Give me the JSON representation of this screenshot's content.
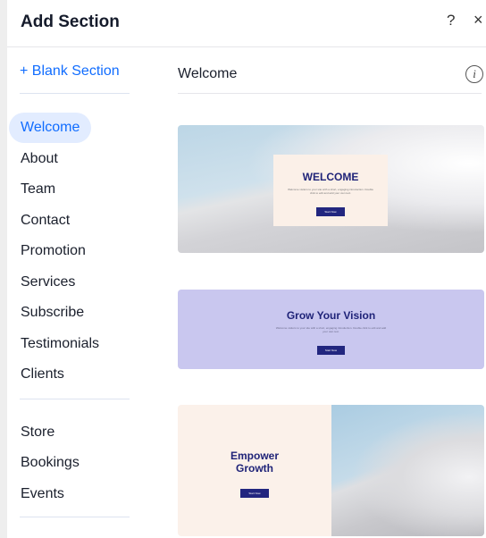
{
  "header": {
    "title": "Add Section",
    "help_label": "?",
    "close_label": "×"
  },
  "sidebar": {
    "blank_section": "+ Blank Section",
    "group1": [
      "Welcome",
      "About",
      "Team",
      "Contact",
      "Promotion",
      "Services",
      "Subscribe",
      "Testimonials",
      "Clients"
    ],
    "group2": [
      "Store",
      "Bookings",
      "Events"
    ],
    "active": "Welcome"
  },
  "main": {
    "title": "Welcome",
    "info_label": "i",
    "cards": [
      {
        "heading": "WELCOME",
        "body": "Welcome visitors to your site with a short, engaging introduction. Double click to edit and add your own text.",
        "button": "Start Now"
      },
      {
        "heading": "Grow Your Vision",
        "body": "Welcome visitors to your site with a short, engaging introduction. Double click to edit and add your own text.",
        "button": "Start Now"
      },
      {
        "heading_line1": "Empower",
        "heading_line2": "Growth",
        "button": "Start Now"
      }
    ]
  },
  "colors": {
    "accent": "#116dff",
    "active_bg": "#e2ecff",
    "card_button": "#22267f",
    "card2_bg": "#c9c7ef",
    "card_cream": "#fbf0e8"
  }
}
